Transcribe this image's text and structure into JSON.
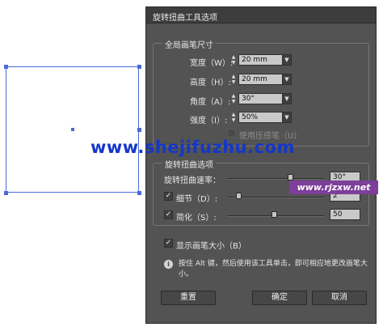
{
  "dialog": {
    "title": "旋转扭曲工具选项",
    "global_brush": {
      "legend": "全局画笔尺寸",
      "width_label": "宽度（W）:",
      "width_value": "20 mm",
      "height_label": "高度（H）:",
      "height_value": "20 mm",
      "angle_label": "角度（A）:",
      "angle_value": "30°",
      "intensity_label": "强度（I）:",
      "intensity_value": "50%",
      "pressure_label": "使用压感笔（U）",
      "pressure_checked": false
    },
    "twirl_options": {
      "legend": "旋转扭曲选项",
      "rate_label": "旋转扭曲速率：",
      "rate_value": "30°",
      "rate_level": 0.65,
      "detail_label": "细节（D）:",
      "detail_value": "2",
      "detail_checked": true,
      "detail_level": 0.12,
      "simplify_label": "简化（S）:",
      "simplify_value": "50",
      "simplify_checked": true,
      "simplify_level": 0.49
    },
    "show_brush_label": "显示画笔大小（B）",
    "show_brush_checked": true,
    "info_text": "按住 Alt 键，然后使用该工具单击，即可相应地更改画笔大小。",
    "buttons": {
      "reset": "重置",
      "ok": "确定",
      "cancel": "取消"
    }
  },
  "watermarks": {
    "main": "www.shejifuzhu.com",
    "secondary": "www.rjzxw.net"
  },
  "icons": {
    "check": "✓",
    "info": "i",
    "spin_up": "▲",
    "spin_down": "▼",
    "dropdown": "▼"
  }
}
